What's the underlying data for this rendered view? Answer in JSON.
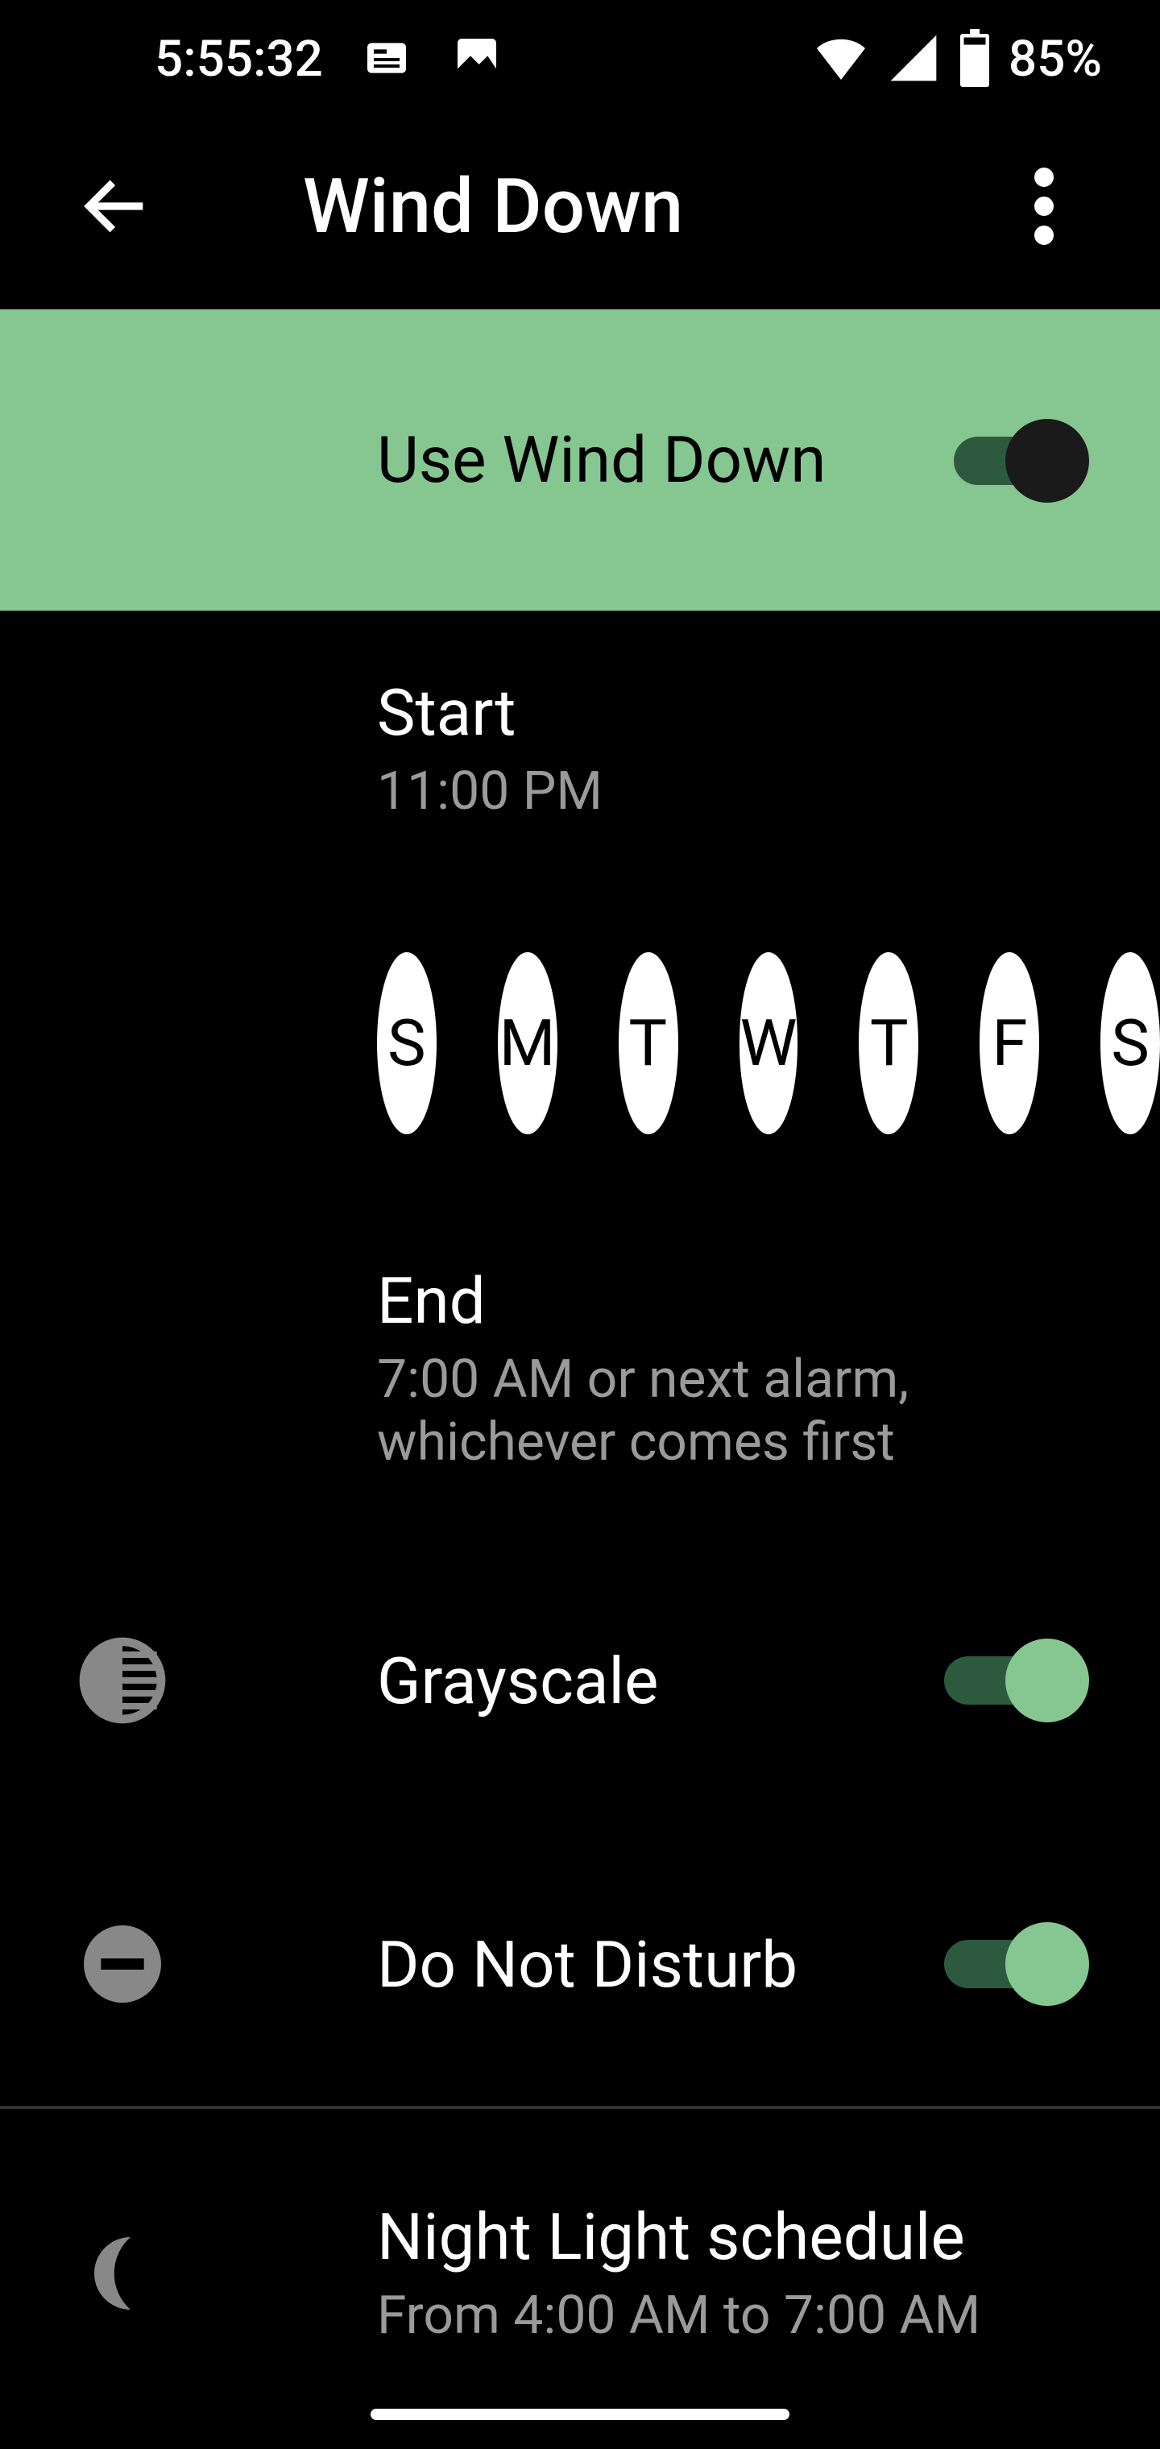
{
  "status_bar": {
    "time": "5:55:32",
    "battery_pct": "85%"
  },
  "app_bar": {
    "title": "Wind Down"
  },
  "master": {
    "label": "Use Wind Down"
  },
  "start": {
    "title": "Start",
    "time": "11:00 PM"
  },
  "days": [
    "S",
    "M",
    "T",
    "W",
    "T",
    "F",
    "S"
  ],
  "end": {
    "title": "End",
    "subtitle": "7:00 AM or next alarm, whichever comes first"
  },
  "grayscale": {
    "label": "Grayscale"
  },
  "dnd": {
    "label": "Do Not Disturb"
  },
  "night_light": {
    "title": "Night Light schedule",
    "subtitle": "From 4:00 AM to 7:00 AM"
  }
}
